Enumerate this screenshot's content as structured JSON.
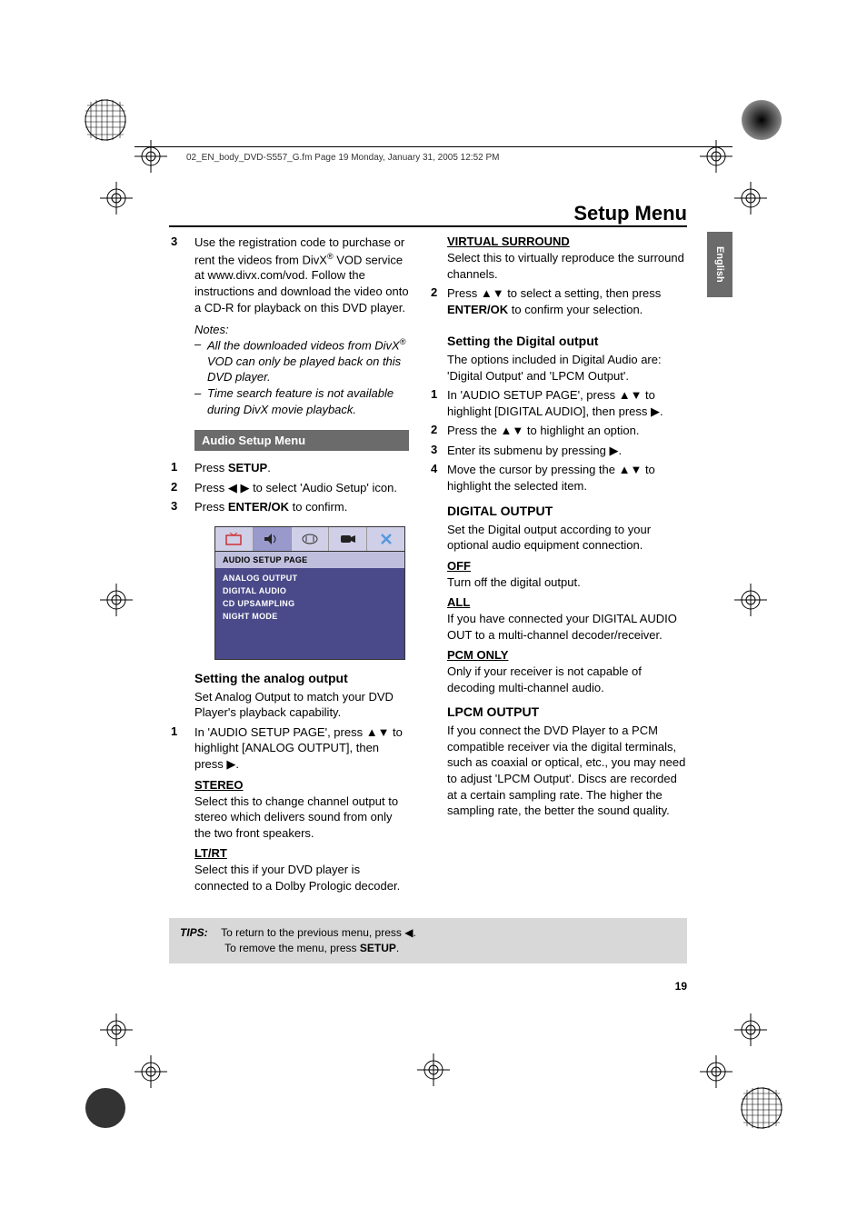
{
  "header": {
    "file_info": "02_EN_body_DVD-S557_G.fm  Page 19  Monday, January 31, 2005  12:52 PM"
  },
  "page_title": "Setup Menu",
  "lang_tab": "English",
  "left": {
    "step3": {
      "num": "3",
      "text_a": "Use the registration code to purchase or rent the videos from DivX",
      "reg": "®",
      "text_b": " VOD service at www.divx.com/vod. Follow the instructions and download the video onto a CD-R for playback on this DVD player."
    },
    "notes_head": "Notes:",
    "note1_a": "All the downloaded videos from DivX",
    "note1_reg": "®",
    "note1_b": " VOD can only be played back on this DVD player.",
    "note2": "Time search feature is not available during DivX movie playback.",
    "audio_bar": "Audio Setup Menu",
    "a1": {
      "num": "1",
      "pre": "Press ",
      "bold": "SETUP",
      "post": "."
    },
    "a2": {
      "num": "2",
      "pre": "Press ",
      "arrows": "◀ ▶",
      "post": " to select 'Audio Setup' icon."
    },
    "a3": {
      "num": "3",
      "pre": "Press ",
      "bold": "ENTER/OK",
      "post": " to confirm."
    },
    "menu": {
      "title": "AUDIO SETUP PAGE",
      "items": [
        "ANALOG OUTPUT",
        "DIGITAL AUDIO",
        "CD UPSAMPLING",
        "NIGHT MODE"
      ]
    },
    "analog_head": "Setting the analog output",
    "analog_body": "Set Analog Output to match your DVD Player's playback capability.",
    "b1": {
      "num": "1",
      "text_a": "In 'AUDIO SETUP PAGE', press ",
      "arrows1": "▲▼",
      "text_b": " to highlight [ANALOG OUTPUT], then press ",
      "arrow2": "▶",
      "text_c": "."
    },
    "stereo_head": "STEREO",
    "stereo_body": "Select this to change channel output to stereo which delivers sound from only the two front speakers.",
    "ltrt_head": "LT/RT",
    "ltrt_body": "Select this if your DVD player is connected to a Dolby Prologic decoder."
  },
  "right": {
    "vs_head": "VIRTUAL SURROUND",
    "vs_body": "Select this to virtually reproduce the surround channels.",
    "r2": {
      "num": "2",
      "text_a": "Press ",
      "arrows": "▲▼",
      "text_b": " to select a setting, then press ",
      "bold": "ENTER/OK",
      "text_c": " to confirm your selection."
    },
    "digital_head": "Setting the Digital output",
    "digital_body": "The options included in Digital Audio are: 'Digital Output' and 'LPCM Output'.",
    "d1": {
      "num": "1",
      "text_a": "In 'AUDIO SETUP PAGE', press ",
      "arrows1": "▲▼",
      "text_b": " to highlight [DIGITAL AUDIO], then press ",
      "arrow2": "▶",
      "text_c": "."
    },
    "d2": {
      "num": "2",
      "text_a": "Press the ",
      "arrows": "▲▼",
      "text_b": " to highlight an option."
    },
    "d3": {
      "num": "3",
      "text_a": "Enter its submenu by pressing ",
      "arrow": "▶",
      "text_b": "."
    },
    "d4": {
      "num": "4",
      "text_a": "Move the cursor by pressing the ",
      "arrows": "▲▼",
      "text_b": " to highlight the selected item."
    },
    "do_head": "DIGITAL OUTPUT",
    "do_body": "Set the Digital output according to your optional audio equipment connection.",
    "off_head": "OFF",
    "off_body": "Turn off the digital output.",
    "all_head": "ALL",
    "all_body": "If you have connected your DIGITAL AUDIO OUT to a multi-channel decoder/receiver.",
    "pcm_head": "PCM ONLY",
    "pcm_body": "Only if your receiver is not capable of decoding multi-channel audio.",
    "lpcm_head": "LPCM OUTPUT",
    "lpcm_body": "If you connect the DVD Player to a PCM compatible receiver via the digital terminals, such as coaxial or optical, etc., you may need to adjust 'LPCM Output'. Discs are recorded at a certain sampling rate. The higher the sampling rate, the better the sound quality."
  },
  "tips": {
    "label": "TIPS:",
    "line1_a": "To return to the previous menu, press ",
    "line1_b": "◀",
    "line1_c": ".",
    "line2_a": "To remove the menu, press ",
    "line2_bold": "SETUP",
    "line2_b": "."
  },
  "page_num": "19"
}
